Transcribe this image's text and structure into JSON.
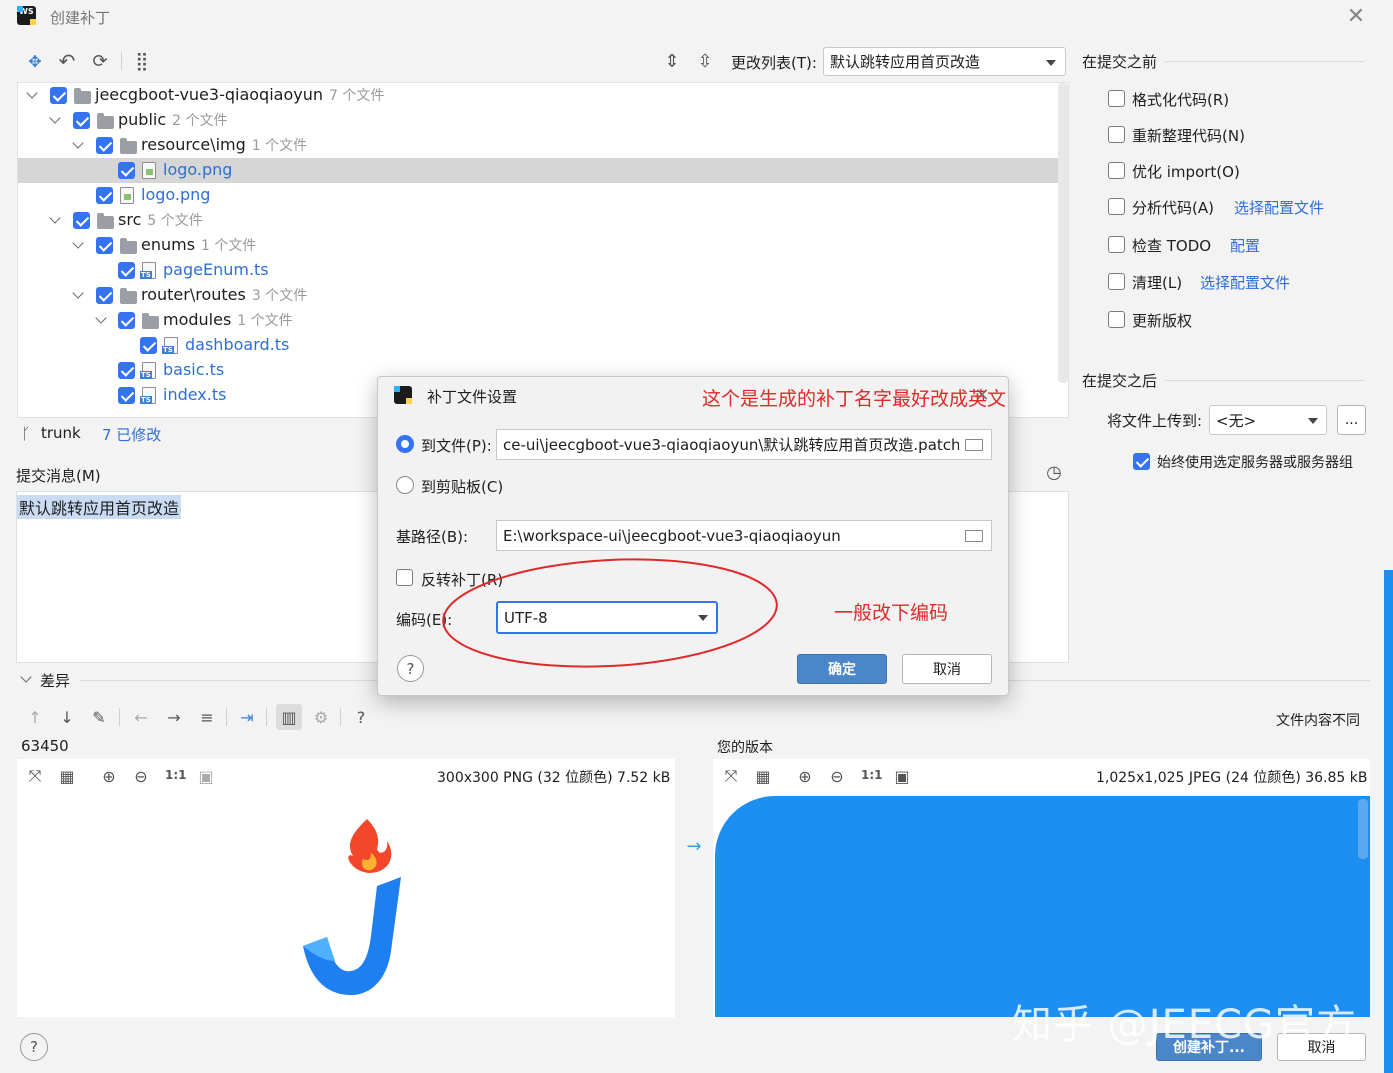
{
  "window": {
    "title": "创建补丁",
    "logo": "WS"
  },
  "toolbar": {
    "changelist_label": "更改列表(T):",
    "changelist_value": "默认跳转应用首页改造"
  },
  "tree": [
    {
      "label": "jeecgboot-vue3-qiaoqiaoyun",
      "count": "7 个文件"
    },
    {
      "label": "public",
      "count": "2 个文件"
    },
    {
      "label": "resource\\img",
      "count": "1 个文件"
    },
    {
      "label": "logo.png",
      "count": ""
    },
    {
      "label": "logo.png",
      "count": ""
    },
    {
      "label": "src",
      "count": "5 个文件"
    },
    {
      "label": "enums",
      "count": "1 个文件"
    },
    {
      "label": "pageEnum.ts",
      "count": ""
    },
    {
      "label": "router\\routes",
      "count": "3 个文件"
    },
    {
      "label": "modules",
      "count": "1 个文件"
    },
    {
      "label": "dashboard.ts",
      "count": ""
    },
    {
      "label": "basic.ts",
      "count": ""
    },
    {
      "label": "index.ts",
      "count": ""
    }
  ],
  "ts_badge": "TS",
  "branch": {
    "name": "trunk",
    "modified": "7 已修改"
  },
  "commit": {
    "label": "提交消息(M)",
    "message": "默认跳转应用首页改造"
  },
  "before_commit": {
    "title": "在提交之前",
    "options": [
      {
        "label": "格式化代码(R)",
        "link": ""
      },
      {
        "label": "重新整理代码(N)",
        "link": ""
      },
      {
        "label": "优化 import(O)",
        "link": ""
      },
      {
        "label": "分析代码(A)",
        "link": "选择配置文件"
      },
      {
        "label": "检查 TODO",
        "link": "配置"
      },
      {
        "label": "清理(L)",
        "link": "选择配置文件"
      },
      {
        "label": "更新版权",
        "link": ""
      }
    ]
  },
  "after_commit": {
    "title": "在提交之后",
    "upload_label": "将文件上传到:",
    "upload_value": "<无>",
    "more_button": "...",
    "always_use": "始终使用选定服务器或服务器组"
  },
  "diff": {
    "title": "差异",
    "left_version": "63450",
    "right_version": "您的版本",
    "status": "文件内容不同",
    "left_info": "300x300 PNG (32 位颜色) 7.52 kB",
    "right_info": "1,025x1,025 JPEG (24 位颜色) 36.85 kB",
    "zoom_1to1": "1:1"
  },
  "dialog": {
    "title": "补丁文件设置",
    "to_file_label": "到文件(P):",
    "to_file_value": "ce-ui\\jeecgboot-vue3-qiaoqiaoyun\\默认跳转应用首页改造.patch",
    "to_clipboard_label": "到剪贴板(C)",
    "base_path_label": "基路径(B):",
    "base_path_value": "E:\\workspace-ui\\jeecgboot-vue3-qiaoqiaoyun",
    "reverse_label": "反转补丁(R)",
    "encoding_label": "编码(E):",
    "encoding_value": "UTF-8",
    "ok": "确定",
    "cancel": "取消",
    "help": "?"
  },
  "annotations": {
    "note_top": "这个是生成的补丁名字最好改成英文",
    "note_encoding": "一般改下编码"
  },
  "footer": {
    "create": "创建补丁...",
    "cancel": "取消",
    "help": "?"
  },
  "watermark": "知乎 @JEECG官方",
  "colors": {
    "accent": "#3574f0",
    "annotation": "#e02a2a",
    "primary_button": "#4a86c8"
  }
}
